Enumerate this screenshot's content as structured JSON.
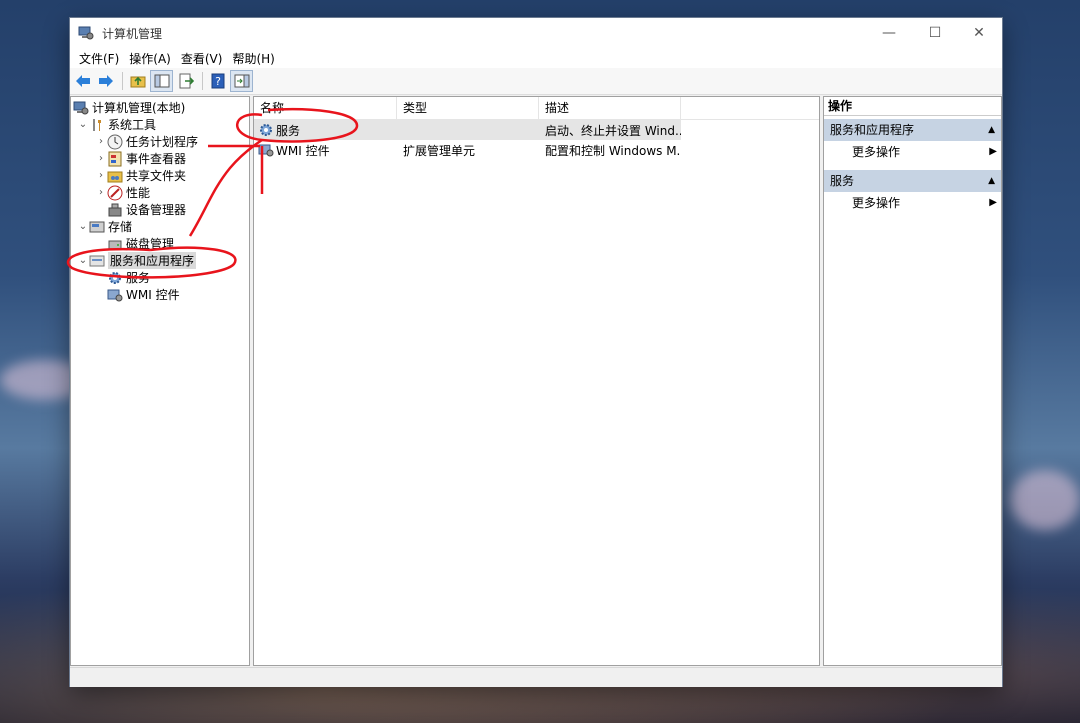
{
  "window": {
    "title": "计算机管理",
    "controls": {
      "minimize": "—",
      "maximize": "☐",
      "close": "✕"
    }
  },
  "menu": [
    "文件(F)",
    "操作(A)",
    "查看(V)",
    "帮助(H)"
  ],
  "tree": {
    "root": "计算机管理(本地)",
    "system_tools": "系统工具",
    "task_scheduler": "任务计划程序",
    "event_viewer": "事件查看器",
    "shared_folders": "共享文件夹",
    "performance": "性能",
    "device_manager": "设备管理器",
    "storage": "存储",
    "disk_management": "磁盘管理",
    "services_apps": "服务和应用程序",
    "services": "服务",
    "wmi": "WMI 控件"
  },
  "list": {
    "columns": {
      "name": "名称",
      "type": "类型",
      "desc": "描述"
    },
    "rows": [
      {
        "name": "服务",
        "type": "",
        "desc": "启动、终止并设置 Wind..."
      },
      {
        "name": "WMI 控件",
        "type": "扩展管理单元",
        "desc": "配置和控制 Windows M..."
      }
    ]
  },
  "actions": {
    "header": "操作",
    "sections": [
      {
        "title": "服务和应用程序",
        "item": "更多操作"
      },
      {
        "title": "服务",
        "item": "更多操作"
      }
    ]
  },
  "colors": {
    "annotation": "#e8141c",
    "section_bg": "#c6d3e3",
    "selection": "#d9d9d9"
  }
}
